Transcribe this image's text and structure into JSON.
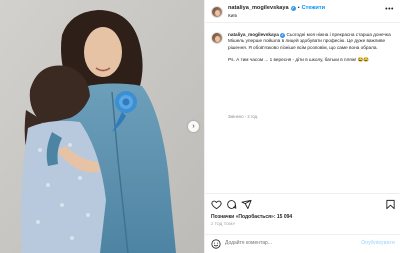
{
  "post": {
    "username": "nataliya_mogilevskaya",
    "follow_label": "Стежити",
    "dot_separator": "•",
    "location": "Київ",
    "more_label": "•••",
    "verified_mark": "✓"
  },
  "caption": {
    "username": "nataliya_mogilevskaya",
    "paragraph1": "Сьогодні моя ніжна і прекрасна старша донечка Мішель уперше пойшла в лицей здобувати професію. Це дуже важливе рішення. Я обов'язково пізніше всім розповім, що саме вона обрала.",
    "paragraph2": "Рs. А тим часом ... 1 вересня - діти в школу, батьки в пляж! 😂😂",
    "meta": "Змінено · 2 год."
  },
  "stats": {
    "likes_label": "Позначки «Подобається»:",
    "likes_count": "15 094",
    "time_ago": "2 ГОД ТОМУ"
  },
  "comment": {
    "placeholder": "Додайте коментар...",
    "publish_label": "Опублікувати",
    "emoji_icon": "smile-icon"
  },
  "carousel": {
    "next_glyph": "›"
  },
  "icons": [
    "heart-icon",
    "comment-icon",
    "share-icon",
    "bookmark-icon",
    "more-icon",
    "verified-icon"
  ]
}
